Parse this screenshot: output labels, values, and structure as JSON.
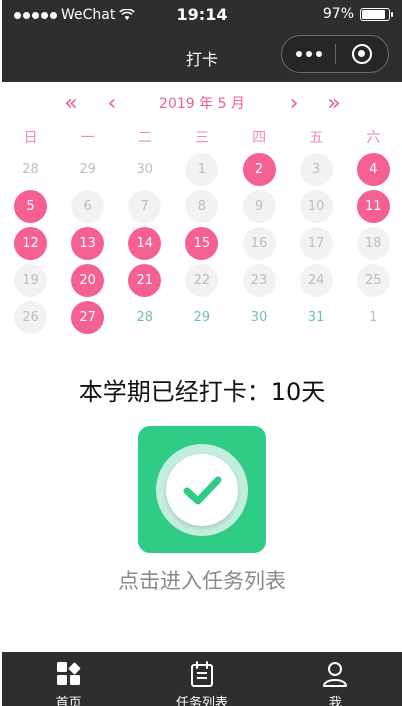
{
  "status": {
    "carrier": "WeChat",
    "time": "19:14",
    "battery": "97%"
  },
  "nav": {
    "title": "打卡"
  },
  "calendar": {
    "prev_year_label": "«",
    "prev_month_label": "‹",
    "month_label": "2019 年 5 月",
    "next_month_label": "›",
    "next_year_label": "»",
    "weekdays": [
      "日",
      "一",
      "二",
      "三",
      "四",
      "五",
      "六"
    ],
    "rows": [
      [
        {
          "d": "28",
          "t": "out"
        },
        {
          "d": "29",
          "t": "out"
        },
        {
          "d": "30",
          "t": "out"
        },
        {
          "d": "1",
          "t": "norm"
        },
        {
          "d": "2",
          "t": "checked"
        },
        {
          "d": "3",
          "t": "norm"
        },
        {
          "d": "4",
          "t": "checked"
        }
      ],
      [
        {
          "d": "5",
          "t": "checked"
        },
        {
          "d": "6",
          "t": "norm"
        },
        {
          "d": "7",
          "t": "norm"
        },
        {
          "d": "8",
          "t": "norm"
        },
        {
          "d": "9",
          "t": "norm"
        },
        {
          "d": "10",
          "t": "norm"
        },
        {
          "d": "11",
          "t": "checked"
        }
      ],
      [
        {
          "d": "12",
          "t": "checked"
        },
        {
          "d": "13",
          "t": "checked"
        },
        {
          "d": "14",
          "t": "checked"
        },
        {
          "d": "15",
          "t": "checked"
        },
        {
          "d": "16",
          "t": "norm"
        },
        {
          "d": "17",
          "t": "norm"
        },
        {
          "d": "18",
          "t": "norm"
        }
      ],
      [
        {
          "d": "19",
          "t": "norm"
        },
        {
          "d": "20",
          "t": "checked"
        },
        {
          "d": "21",
          "t": "checked"
        },
        {
          "d": "22",
          "t": "norm"
        },
        {
          "d": "23",
          "t": "norm"
        },
        {
          "d": "24",
          "t": "norm"
        },
        {
          "d": "25",
          "t": "norm"
        }
      ],
      [
        {
          "d": "26",
          "t": "norm"
        },
        {
          "d": "27",
          "t": "checked"
        },
        {
          "d": "28",
          "t": "future"
        },
        {
          "d": "29",
          "t": "future"
        },
        {
          "d": "30",
          "t": "future"
        },
        {
          "d": "31",
          "t": "future"
        },
        {
          "d": "1",
          "t": "next"
        }
      ]
    ]
  },
  "summary": {
    "text": "本学期已经打卡：10天"
  },
  "task": {
    "icon": "check-icon",
    "enter_label": "点击进入任务列表"
  },
  "tabbar": {
    "items": [
      {
        "label": "首页",
        "icon": "home-grid-icon"
      },
      {
        "label": "任务列表",
        "icon": "calendar-list-icon"
      },
      {
        "label": "我",
        "icon": "user-icon"
      }
    ]
  },
  "colors": {
    "accent": "#f4608f",
    "green": "#2fcc86",
    "bar": "#2e2e2e"
  }
}
